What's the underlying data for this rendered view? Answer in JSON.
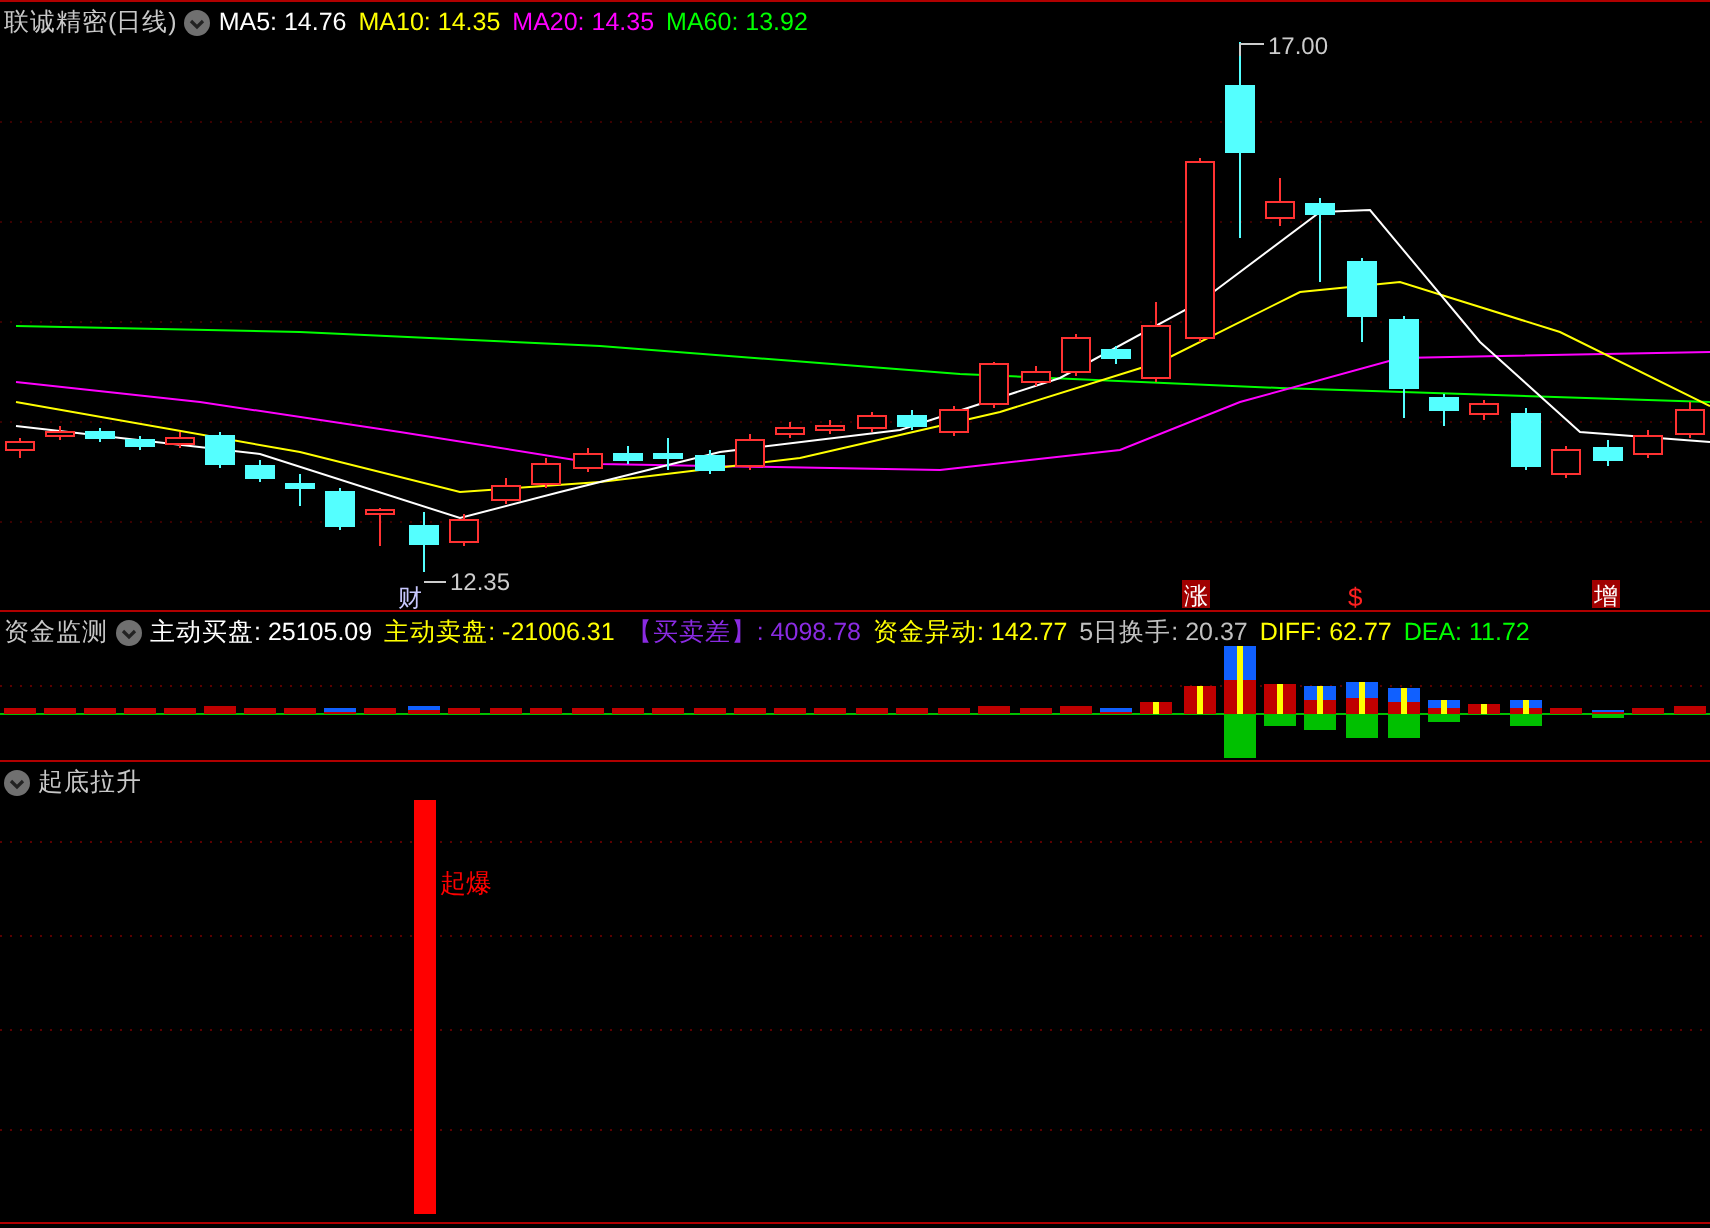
{
  "main_panel": {
    "title": "联诚精密(日线)",
    "indicators": [
      {
        "label": "MA5:",
        "value": "14.76",
        "color": "#ffffff"
      },
      {
        "label": "MA10:",
        "value": "14.35",
        "color": "#ffff00"
      },
      {
        "label": "MA20:",
        "value": "14.35",
        "color": "#ff00ff"
      },
      {
        "label": "MA60:",
        "value": "13.92",
        "color": "#00ff00"
      }
    ],
    "high_label": "17.00",
    "low_label": "12.35",
    "markers": [
      {
        "text": "财",
        "kind": "plain"
      },
      {
        "text": "涨",
        "kind": "boxed"
      },
      {
        "text": "$",
        "kind": "red"
      },
      {
        "text": "增",
        "kind": "boxed"
      }
    ]
  },
  "funds_panel": {
    "title": "资金监测",
    "indicators": [
      {
        "label": "主动买盘:",
        "value": "25105.09",
        "color": "#ffffff"
      },
      {
        "label": "主动卖盘:",
        "value": "-21006.31",
        "color": "#ffff00"
      },
      {
        "label": "【买卖差】:",
        "value": "4098.78",
        "color": "#8a2be2"
      },
      {
        "label": "资金异动:",
        "value": "142.77",
        "color": "#ffff00"
      },
      {
        "label": "5日换手:",
        "value": "20.37",
        "color": "#c0c0c0"
      },
      {
        "label": "DIFF:",
        "value": "62.77",
        "color": "#ffff00"
      },
      {
        "label": "DEA:",
        "value": "11.72",
        "color": "#00ff00"
      }
    ]
  },
  "signal_panel": {
    "title": "起底拉升",
    "signal_label": "起爆"
  }
}
